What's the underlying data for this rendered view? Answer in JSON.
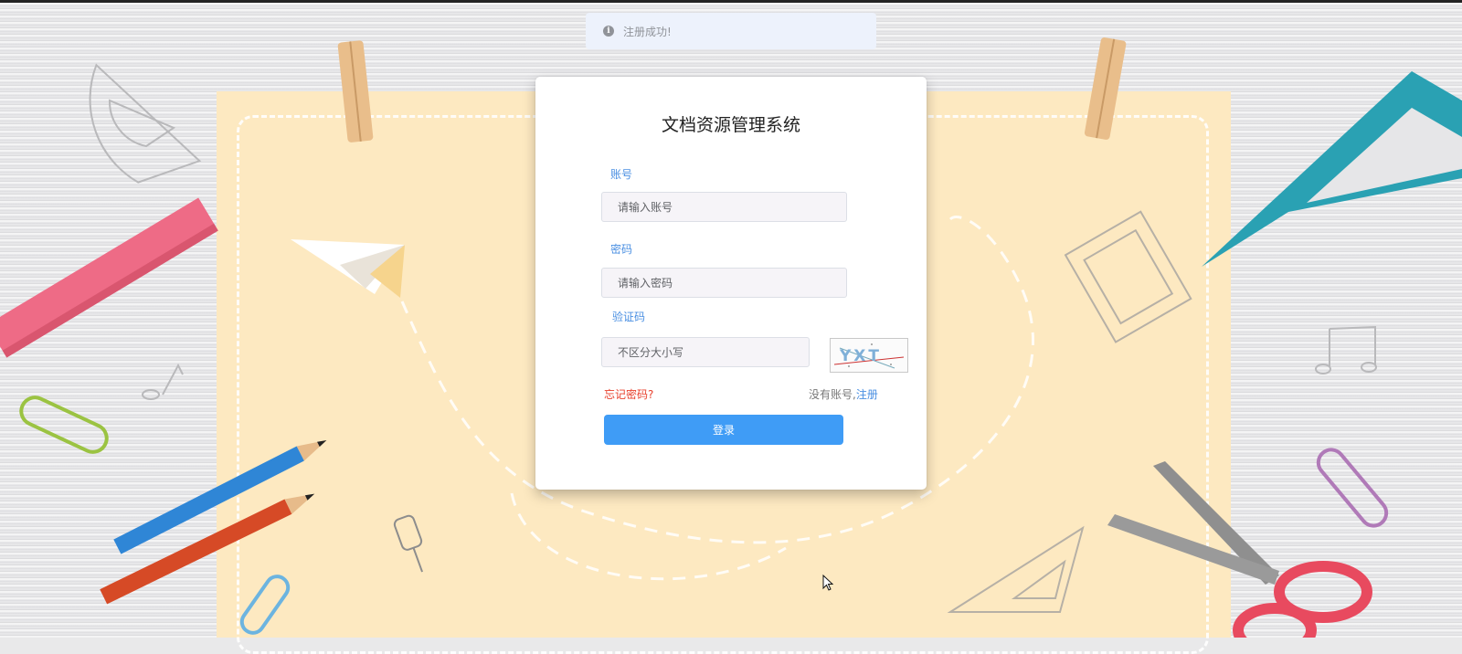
{
  "toast": {
    "icon": "info-icon",
    "message": "注册成功!"
  },
  "login": {
    "title": "文档资源管理系统",
    "account_label": "账号",
    "account_placeholder": "请输入账号",
    "password_label": "密码",
    "password_placeholder": "请输入密码",
    "captcha_label": "验证码",
    "captcha_placeholder": "不区分大小写",
    "captcha_text": "YXT",
    "forgot_password": "忘记密码?",
    "no_account": "没有账号,",
    "register_link": "注册",
    "login_button": "登录"
  },
  "colors": {
    "accent": "#3f9cf6",
    "label": "#4a8fe2",
    "forgot": "#e8412d",
    "paper": "#fde9c1"
  }
}
